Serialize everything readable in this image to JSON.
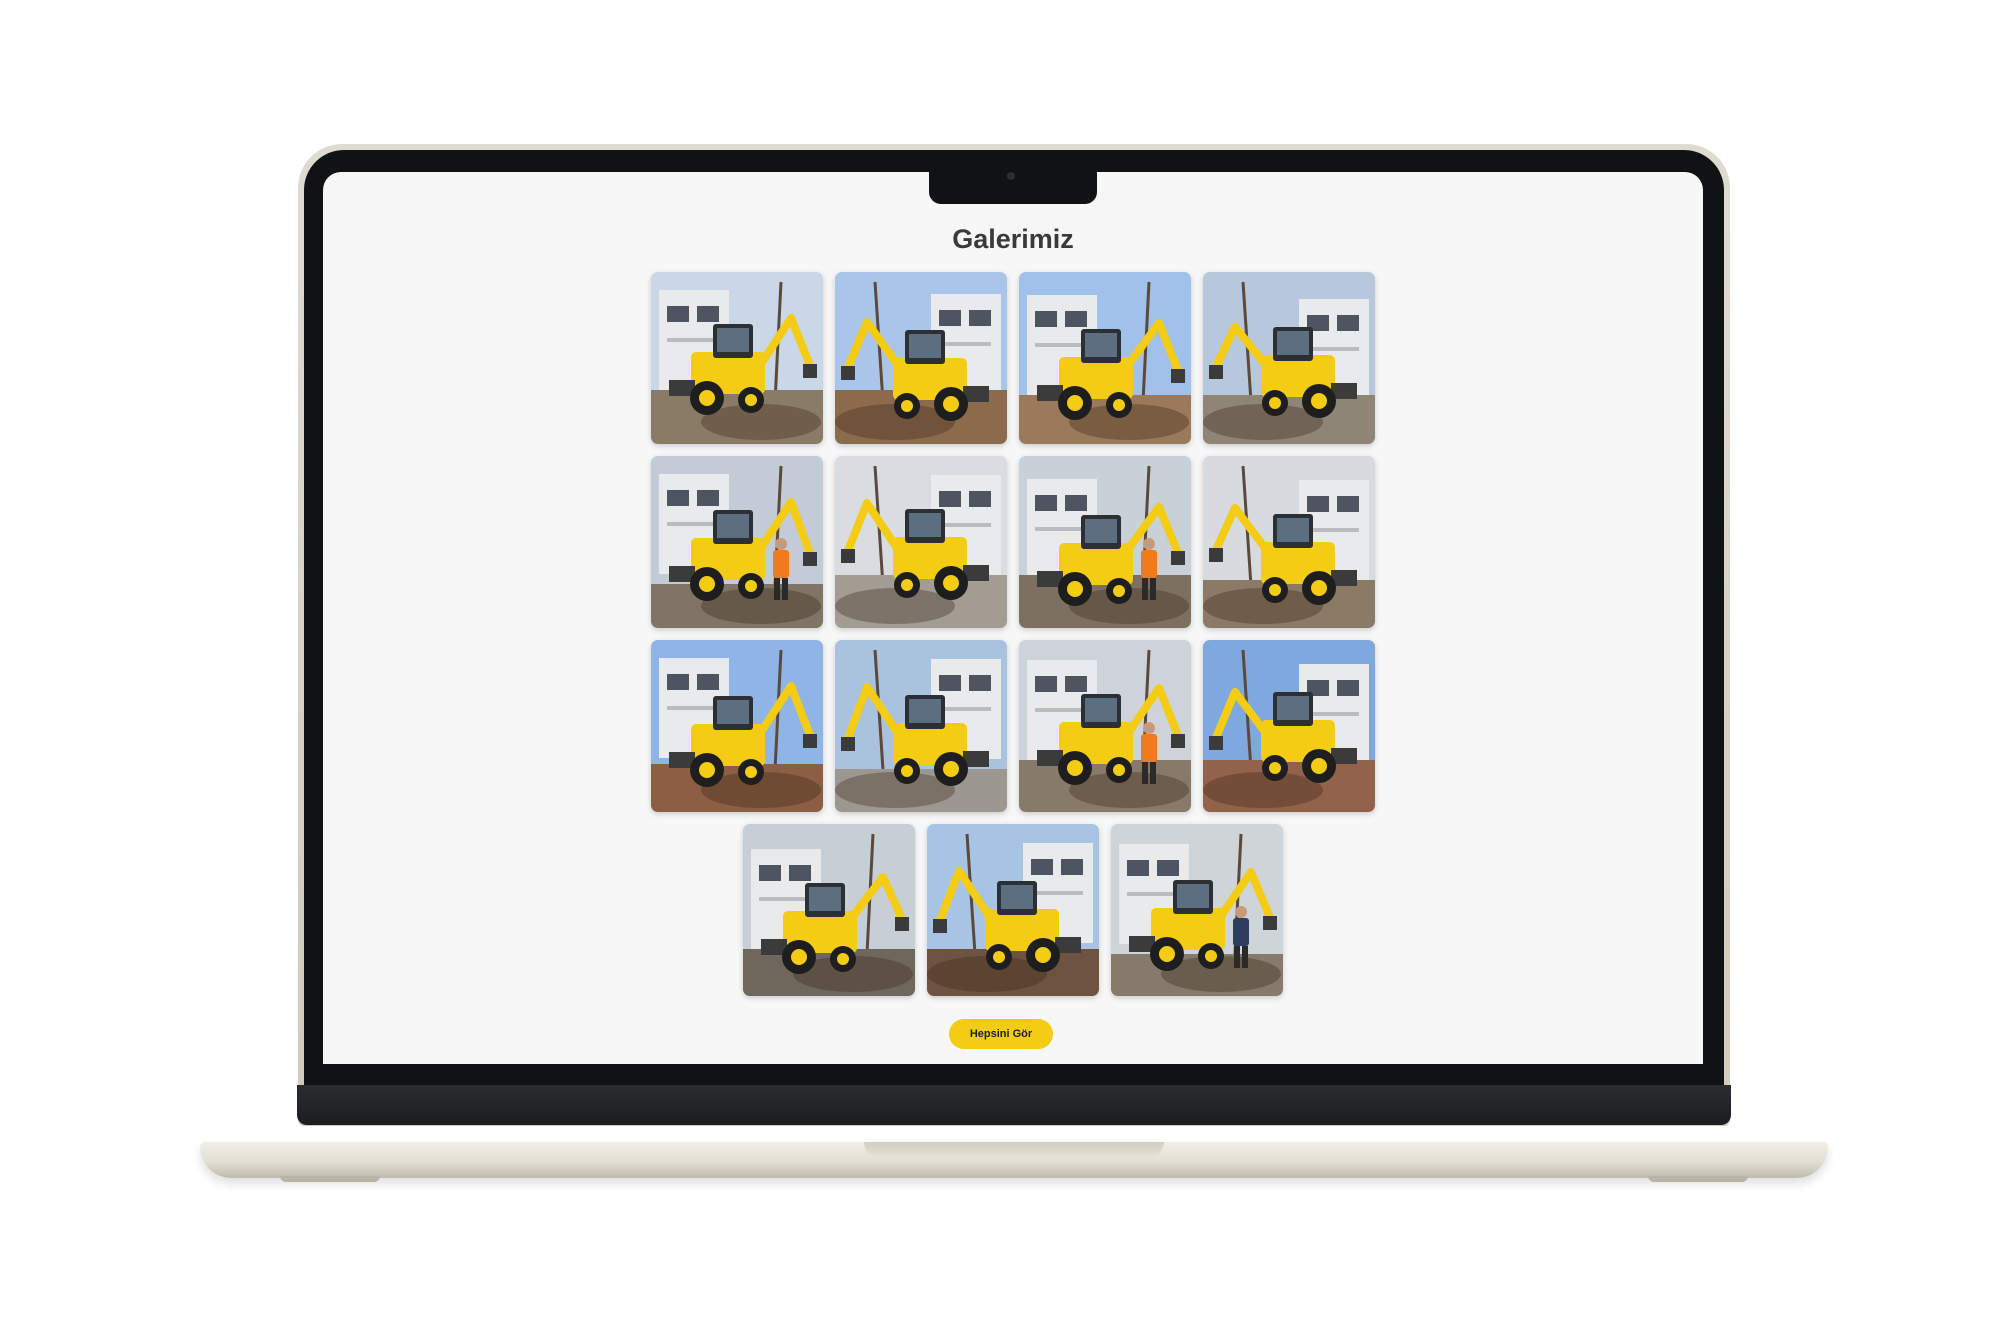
{
  "gallery": {
    "title": "Galerimiz",
    "button_label": "Hepsini Gör",
    "accent_color": "#f4cc14",
    "photos": [
      {
        "icon": "backhoe-photo",
        "sky": "#c9d7e6",
        "ground": "#8a7b66"
      },
      {
        "icon": "backhoe-photo",
        "sky": "#a9c6ea",
        "ground": "#8c6a4c"
      },
      {
        "icon": "backhoe-photo",
        "sky": "#9fc1ea",
        "ground": "#9a7a5a"
      },
      {
        "icon": "backhoe-photo",
        "sky": "#b7c8dc",
        "ground": "#8e8577"
      },
      {
        "icon": "backhoe-photo",
        "sky": "#c3ccd6",
        "ground": "#7f7465"
      },
      {
        "icon": "backhoe-photo",
        "sky": "#d9dde2",
        "ground": "#a29c93"
      },
      {
        "icon": "backhoe-photo",
        "sky": "#c8d0d8",
        "ground": "#7d7061"
      },
      {
        "icon": "backhoe-photo",
        "sky": "#d7dbe0",
        "ground": "#8a7a66"
      },
      {
        "icon": "backhoe-photo",
        "sky": "#8fb4e6",
        "ground": "#8c5e43"
      },
      {
        "icon": "backhoe-photo",
        "sky": "#a9c2de",
        "ground": "#9d988f"
      },
      {
        "icon": "backhoe-photo",
        "sky": "#cdd3d9",
        "ground": "#887a68"
      },
      {
        "icon": "backhoe-photo",
        "sky": "#7fa8de",
        "ground": "#93624a"
      },
      {
        "icon": "backhoe-photo",
        "sky": "#c6ced6",
        "ground": "#6f665c"
      },
      {
        "icon": "backhoe-photo",
        "sky": "#a8c4e4",
        "ground": "#6e5440"
      },
      {
        "icon": "backhoe-photo",
        "sky": "#cfd4d9",
        "ground": "#857a6b"
      }
    ]
  }
}
